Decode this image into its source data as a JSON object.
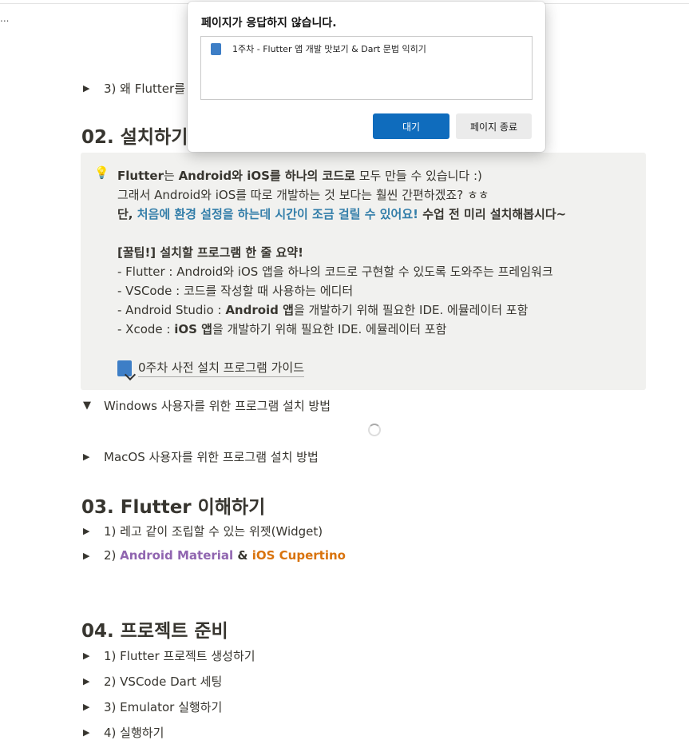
{
  "page": {
    "ellipsis": "...",
    "partial_text": "...",
    "toggle_3": "3) 왜 Flutter를",
    "section2": "02. 설치하기",
    "callout": {
      "line1_a": "Flutter",
      "line1_b": "는 ",
      "line1_c": "Android",
      "line1_d": "와 ",
      "line1_e": "iOS",
      "line1_f": "를 하나의 코드로",
      "line1_g": " 모두 만들 수 있습니다 :)",
      "line2": "그래서 Android와 iOS를 따로 개발하는 것 보다는 훨씬 간편하겠죠? ㅎㅎ",
      "line3_a": "단, ",
      "line3_b": "처음에 환경 설정을 하는데  시간이 조금 걸릴 수 있어요!",
      "line3_c": " 수업 전 미리 설치해봅시다~",
      "tip_title": "[꿀팁!] 설치할 프로그램 한 줄 요약!",
      "tip1": "- Flutter : Android와 iOS 앱을 하나의 코드로 구현할 수 있도록 도와주는 프레임워크",
      "tip2": "- VSCode : 코드를 작성할 때 사용하는 에디터",
      "tip3_a": "- Android Studio : ",
      "tip3_b": "Android 앱",
      "tip3_c": "을 개발하기 위해 필요한 IDE. 에뮬레이터 포함",
      "tip4_a": "- Xcode : ",
      "tip4_b": "iOS 앱",
      "tip4_c": "을 개발하기 위해 필요한 IDE. 에뮬레이터 포함",
      "guide_link": "0주차 사전 설치 프로그램 가이드"
    },
    "windows_toggle": "Windows 사용자를 위한 프로그램 설치 방법",
    "mac_toggle": "MacOS 사용자를 위한 프로그램 설치 방법",
    "section3": "03. Flutter 이해하기",
    "s3_items": {
      "item1": "1) 레고 같이 조립할 수 있는 위젯(Widget)",
      "item2_a": "2) ",
      "item2_b": "Android Material",
      "item2_c": " & ",
      "item2_d": "iOS Cupertino"
    },
    "section4": "04. 프로젝트 준비",
    "s4_items": [
      "1) Flutter 프로젝트 생성하기",
      "2) VSCode Dart 세팅",
      "3) Emulator 실행하기",
      "4) 실행하기"
    ]
  },
  "dialog": {
    "title": "페이지가 응답하지 않습니다.",
    "list_item": "1주차 - Flutter 앱 개발 맛보기 & Dart 문법 익히기",
    "wait_button": "대기",
    "end_button": "페이지 종료"
  },
  "colors": {
    "accent": "#0f6cbd",
    "link_blue": "#337ea9",
    "purple": "#9065b0",
    "orange": "#d9730d",
    "callout_bg": "#f1f1ef"
  }
}
